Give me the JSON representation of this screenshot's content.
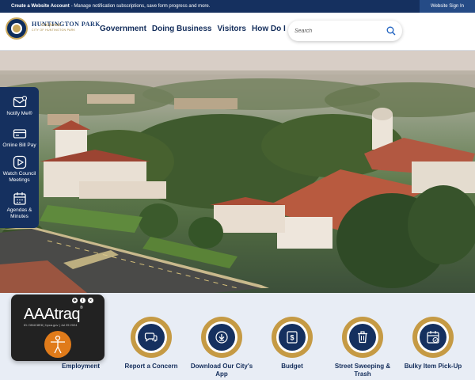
{
  "topbar": {
    "cta_strong": "Create a Website Account",
    "cta_text": " - Manage notification subscriptions, save form progress and more.",
    "signin": "Website Sign In"
  },
  "header": {
    "logo_main": "HUNTINGTON PARK",
    "logo_sub": "CITY OF HUNTINGTON PARK",
    "logo_script": "California",
    "nav": [
      "Government",
      "Doing Business",
      "Visitors",
      "How Do I"
    ],
    "search_placeholder": "Search"
  },
  "sidebar": {
    "items": [
      {
        "label": "Notify Me®",
        "icon": "notify-icon"
      },
      {
        "label": "Online Bill Pay",
        "icon": "bill-icon"
      },
      {
        "label": "Watch Council Meetings",
        "icon": "play-icon"
      },
      {
        "label": "Agendas & Minutes",
        "icon": "calendar-icon"
      }
    ]
  },
  "quicklinks": [
    {
      "label": "Employment",
      "icon": "employment-icon"
    },
    {
      "label": "Report a Concern",
      "icon": "chat-icon"
    },
    {
      "label": "Download Our City's App",
      "icon": "download-icon"
    },
    {
      "label": "Budget",
      "icon": "dollar-icon"
    },
    {
      "label": "Street Sweeping & Trash",
      "icon": "trash-icon"
    },
    {
      "label": "Bulky Item Pick-Up",
      "icon": "calendar-check-icon"
    }
  ],
  "badge": {
    "title": "AAAtraq",
    "tm": "®",
    "meta": "ID: DB4C8E8 | hpca.gov | Jul 25 2024"
  },
  "colors": {
    "navy": "#15305f",
    "gold": "#c59a44"
  }
}
